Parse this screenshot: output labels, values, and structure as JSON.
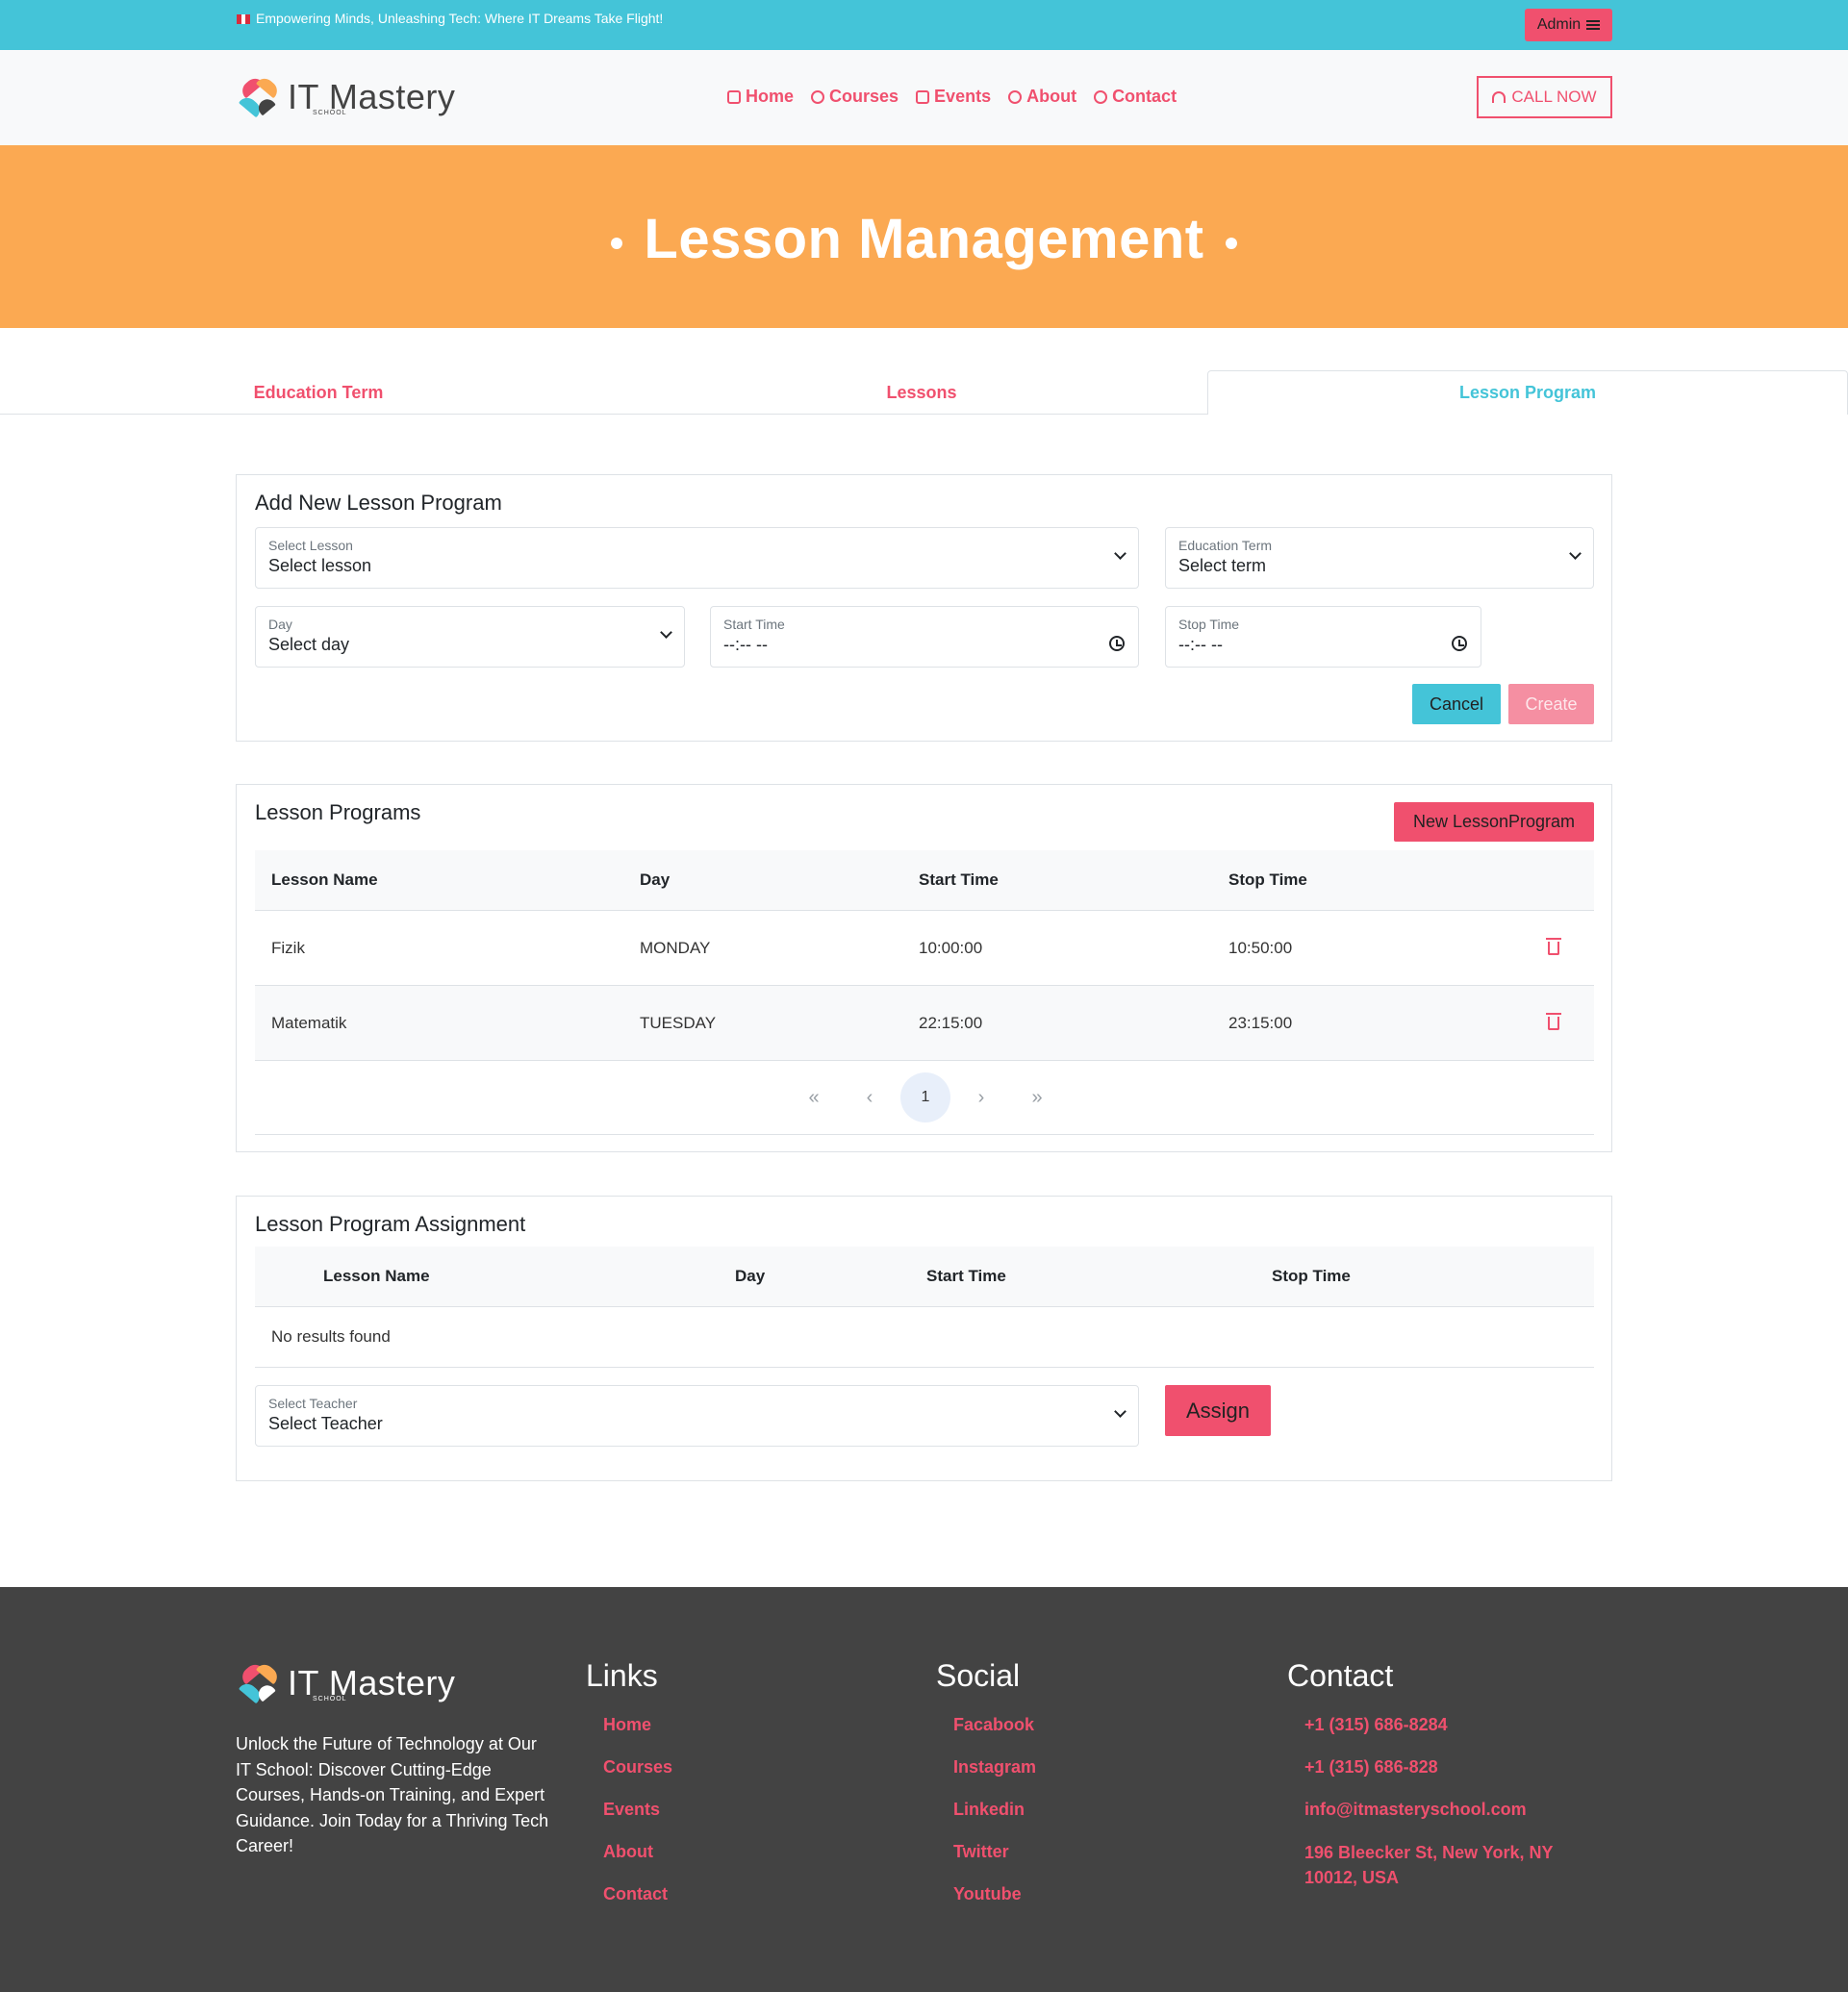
{
  "topbar": {
    "message": "Empowering Minds, Unleashing Tech: Where IT Dreams Take Flight!",
    "admin_label": "Admin"
  },
  "header": {
    "logo_text": "IT Mastery",
    "logo_sub": "SCHOOL",
    "nav": [
      {
        "label": "Home",
        "icon": "home-icon"
      },
      {
        "label": "Courses",
        "icon": "aperture-icon"
      },
      {
        "label": "Events",
        "icon": "calendar-icon"
      },
      {
        "label": "About",
        "icon": "award-icon"
      },
      {
        "label": "Contact",
        "icon": "headphones-icon"
      }
    ],
    "call_label": "CALL NOW"
  },
  "hero": {
    "title": "Lesson Management"
  },
  "tabs": [
    "Education Term",
    "Lessons",
    "Lesson Program"
  ],
  "add_form": {
    "title": "Add New Lesson Program",
    "lesson": {
      "label": "Select Lesson",
      "value": "Select lesson"
    },
    "term": {
      "label": "Education Term",
      "value": "Select term"
    },
    "day": {
      "label": "Day",
      "value": "Select day"
    },
    "start": {
      "label": "Start Time",
      "value": "--:-- --"
    },
    "stop": {
      "label": "Stop Time",
      "value": "--:-- --"
    },
    "cancel_label": "Cancel",
    "create_label": "Create"
  },
  "programs": {
    "title": "Lesson Programs",
    "new_label": "New LessonProgram",
    "columns": [
      "Lesson Name",
      "Day",
      "Start Time",
      "Stop Time"
    ],
    "rows": [
      {
        "name": "Fizik",
        "day": "MONDAY",
        "start": "10:00:00",
        "stop": "10:50:00"
      },
      {
        "name": "Matematik",
        "day": "TUESDAY",
        "start": "22:15:00",
        "stop": "23:15:00"
      }
    ],
    "pager": {
      "first": "«",
      "prev": "‹",
      "current": "1",
      "next": "›",
      "last": "»"
    }
  },
  "assignment": {
    "title": "Lesson Program Assignment",
    "columns": [
      "Lesson Name",
      "Day",
      "Start Time",
      "Stop Time"
    ],
    "empty": "No results found",
    "teacher": {
      "label": "Select Teacher",
      "value": "Select Teacher"
    },
    "assign_label": "Assign"
  },
  "footer": {
    "logo_text": "IT Mastery",
    "logo_sub": "SCHOOL",
    "about": "Unlock the Future of Technology at Our IT School: Discover Cutting-Edge Courses, Hands-on Training, and Expert Guidance. Join Today for a Thriving Tech Career!",
    "links_title": "Links",
    "links": [
      "Home",
      "Courses",
      "Events",
      "About",
      "Contact"
    ],
    "social_title": "Social",
    "social": [
      "Facabook",
      "Instagram",
      "Linkedin",
      "Twitter",
      "Youtube"
    ],
    "contact_title": "Contact",
    "contact": [
      "+1 (315) 686-8284",
      "+1 (315) 686-828",
      "info@itmasteryschool.com",
      "196 Bleecker St, New York, NY 10012, USA"
    ]
  },
  "colors": {
    "accent": "#f0506e",
    "teal": "#44c4d8",
    "orange": "#fba952",
    "footer": "#434343"
  }
}
